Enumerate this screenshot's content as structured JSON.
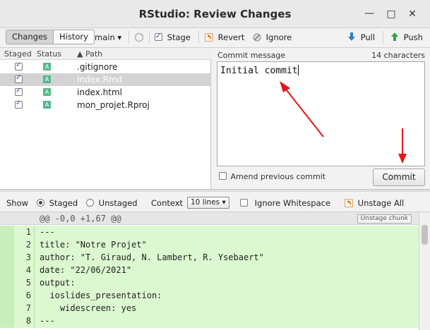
{
  "window": {
    "title": "RStudio: Review Changes",
    "minimize_glyph": "—",
    "maximize_glyph": "□",
    "close_glyph": "✕"
  },
  "toolbar": {
    "tab_changes": "Changes",
    "tab_history": "History",
    "branch": "main ▾",
    "stage": "Stage",
    "revert": "Revert",
    "ignore": "Ignore",
    "pull": "Pull",
    "push": "Push"
  },
  "file_list": {
    "headers": {
      "staged": "Staged",
      "status": "Status",
      "path": "▲ Path"
    },
    "files": [
      {
        "staged": true,
        "status": "A",
        "path": ".gitignore",
        "selected": false
      },
      {
        "staged": true,
        "status": "A",
        "path": "index.Rmd",
        "selected": true
      },
      {
        "staged": true,
        "status": "A",
        "path": "index.html",
        "selected": false
      },
      {
        "staged": true,
        "status": "A",
        "path": "mon_projet.Rproj",
        "selected": false
      }
    ]
  },
  "commit": {
    "label": "Commit message",
    "char_count": "14 characters",
    "message": "Initial commit",
    "amend_label": "Amend previous commit",
    "amend_checked": false,
    "button": "Commit"
  },
  "diff_toolbar": {
    "show_label": "Show",
    "staged": "Staged",
    "unstaged": "Unstaged",
    "show_selected": "staged",
    "context_label": "Context",
    "context_value": "10 lines ▾",
    "ignore_whitespace": "Ignore Whitespace",
    "unstage_all": "Unstage All"
  },
  "diff": {
    "chunk_header": "@@ -0,0 +1,67 @@",
    "unstage_chunk": "Unstage chunk",
    "lines": [
      {
        "num": "1",
        "text": "---"
      },
      {
        "num": "2",
        "text": "title: \"Notre Projet\""
      },
      {
        "num": "3",
        "text": "author: \"T. Giraud, N. Lambert, R. Ysebaert\""
      },
      {
        "num": "4",
        "text": "date: \"22/06/2021\""
      },
      {
        "num": "5",
        "text": "output:"
      },
      {
        "num": "6",
        "text": "  ioslides_presentation:"
      },
      {
        "num": "7",
        "text": "    widescreen: yes"
      },
      {
        "num": "8",
        "text": "---"
      }
    ]
  },
  "colors": {
    "annotation_arrow": "#e8141c",
    "added_line_bg": "#dcf8d0",
    "status_added": "#54b98b",
    "selected_row": "#d3d3d3"
  }
}
